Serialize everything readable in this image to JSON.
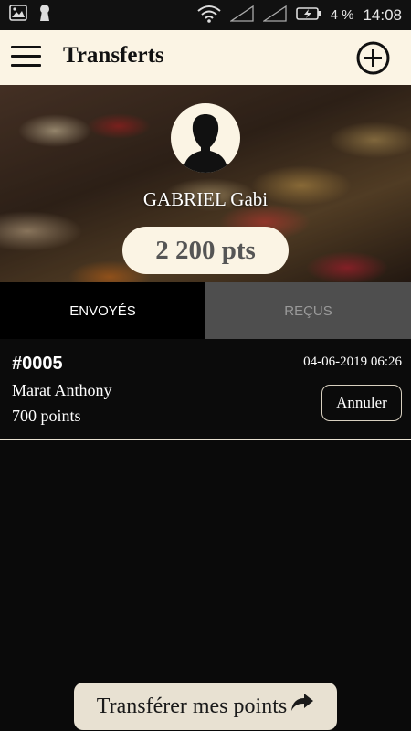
{
  "status_bar": {
    "battery_percent": "4 %",
    "time": "14:08",
    "icons": [
      "image-icon",
      "keyhole-icon",
      "wifi-icon",
      "signal-icon",
      "signal-icon",
      "battery-charging-icon"
    ]
  },
  "app_bar": {
    "title": "Transferts",
    "icons": [
      "menu-icon",
      "add-circle-icon"
    ]
  },
  "profile": {
    "name": "GABRIEL Gabi",
    "points": "2 200 pts",
    "avatar_icon": "user-silhouette-icon"
  },
  "tabs": [
    {
      "label": "ENVOYÉS",
      "active": true
    },
    {
      "label": "REÇUS",
      "active": false
    }
  ],
  "transfers": [
    {
      "id": "#0005",
      "date": "04-06-2019 06:26",
      "recipient": "Marat Anthony",
      "points": "700 points",
      "action_label": "Annuler"
    }
  ],
  "footer": {
    "transfer_button_label": "Transférer mes points",
    "transfer_button_icon": "share-arrow-icon"
  },
  "colors": {
    "cream": "#fbf4e4",
    "background": "#0a0a0a",
    "tab_inactive": "#4e4e4e"
  }
}
